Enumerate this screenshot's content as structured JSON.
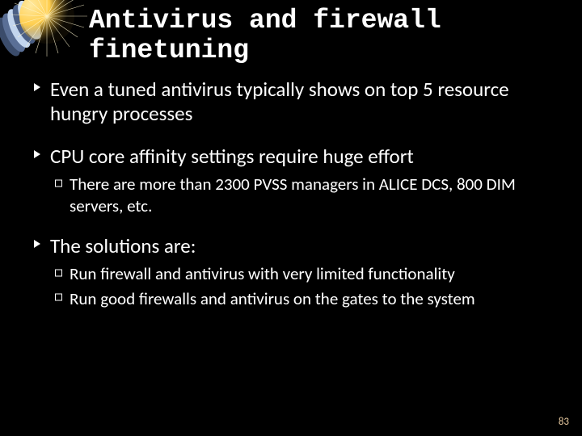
{
  "title": "Antivirus and firewall finetuning",
  "bullets": [
    {
      "text": "Even a tuned antivirus typically shows on top 5 resource hungry processes",
      "sub": []
    },
    {
      "text": "CPU core affinity settings require huge effort",
      "sub": [
        "There are more than 2300 PVSS managers in ALICE DCS, 800 DIM servers, etc."
      ]
    },
    {
      "text": "The solutions are:",
      "sub": [
        "Run firewall and antivirus with very limited functionality",
        "Run good firewalls and antivirus on the gates to the system"
      ]
    }
  ],
  "page_number": "83",
  "decor": {
    "color1": "#ffd560",
    "color2": "#566b8f",
    "color3": "#c5d9f0",
    "accent": "#ffffff"
  }
}
